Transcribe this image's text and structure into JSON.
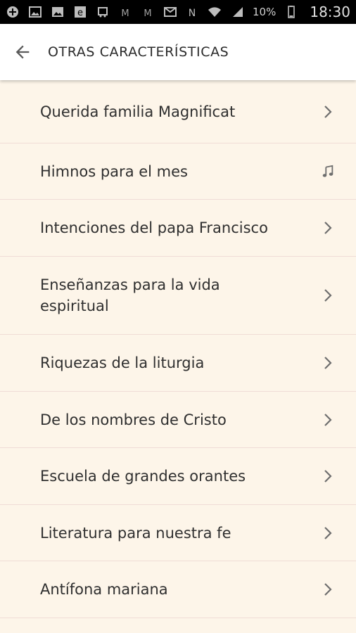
{
  "status_bar": {
    "battery": "10%",
    "time": "18:30",
    "icons": [
      "add-icon",
      "image-icon",
      "gallery-icon",
      "e-icon",
      "bus-icon",
      "gmail-icon",
      "gmail-icon",
      "mail-icon",
      "nfc-icon",
      "wifi-icon",
      "signal-icon",
      "battery-icon"
    ]
  },
  "header": {
    "title": "OTRAS CARACTERÍSTICAS",
    "back_icon": "arrow-back-icon"
  },
  "list": {
    "items": [
      {
        "label": "Querida familia Magnificat",
        "icon": "chevron-right-icon"
      },
      {
        "label": "Himnos para el mes",
        "icon": "music-note-icon"
      },
      {
        "label": "Intenciones del papa Francisco",
        "icon": "chevron-right-icon"
      },
      {
        "label": "Enseñanzas para la vida espiritual",
        "icon": "chevron-right-icon"
      },
      {
        "label": "Riquezas de la liturgia",
        "icon": "chevron-right-icon"
      },
      {
        "label": "De los nombres de Cristo",
        "icon": "chevron-right-icon"
      },
      {
        "label": "Escuela de grandes orantes",
        "icon": "chevron-right-icon"
      },
      {
        "label": "Literatura para nuestra fe",
        "icon": "chevron-right-icon"
      },
      {
        "label": "Antífona mariana",
        "icon": "chevron-right-icon"
      }
    ]
  },
  "colors": {
    "background": "#fdf5e9",
    "divider": "#f0dcd6",
    "text": "#2f2f2f",
    "icon": "#6e6e6e",
    "appbar": "#ffffff",
    "statusbar": "#000000"
  }
}
